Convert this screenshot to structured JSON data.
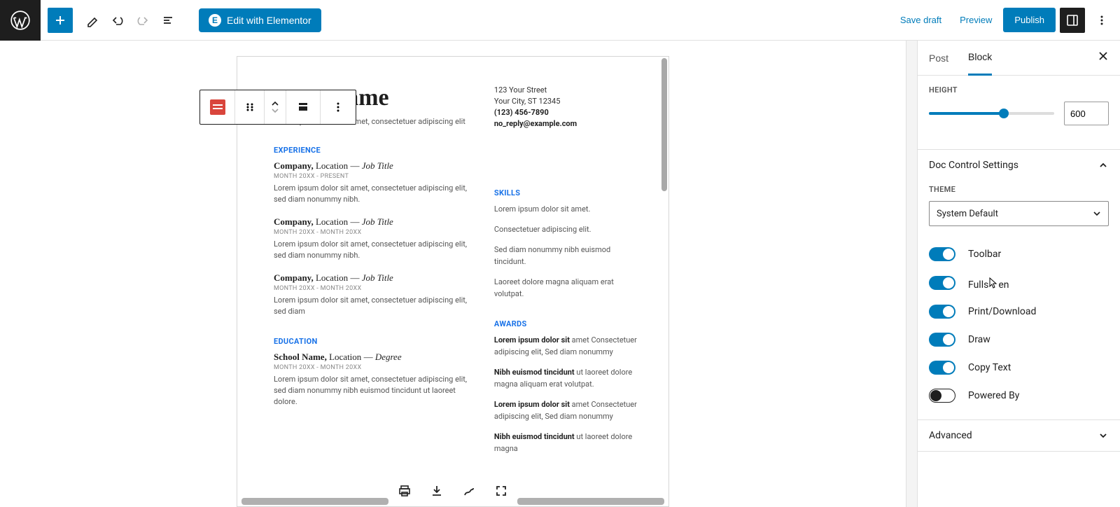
{
  "toolbar": {
    "edit_elementor": "Edit with Elementor",
    "save_draft": "Save draft",
    "preview": "Preview",
    "publish": "Publish"
  },
  "block_toolbar": {
    "icon": "pdf-block"
  },
  "document": {
    "name": "Your Name",
    "subtitle": "Lorem ipsum dolor sit amet, consectetuer adipiscing elit",
    "contact": {
      "street": "123 Your Street",
      "city": "Your City, ST 12345",
      "phone": "(123) 456-7890",
      "email": "no_reply@example.com"
    },
    "sections": {
      "experience": "EXPERIENCE",
      "education": "EDUCATION",
      "skills": "SKILLS",
      "awards": "AWARDS"
    },
    "jobs": [
      {
        "company": "Company,",
        "loc": " Location ",
        "dash": "— ",
        "title": "Job Title",
        "date": "MONTH 20XX - PRESENT",
        "desc": "Lorem ipsum dolor sit amet, consectetuer adipiscing elit, sed diam nonummy nibh."
      },
      {
        "company": "Company,",
        "loc": " Location ",
        "dash": "— ",
        "title": "Job Title",
        "date": "MONTH 20XX - MONTH 20XX",
        "desc": "Lorem ipsum dolor sit amet, consectetuer adipiscing elit, sed diam nonummy nibh."
      },
      {
        "company": "Company,",
        "loc": " Location ",
        "dash": "— ",
        "title": "Job Title",
        "date": "MONTH 20XX - MONTH 20XX",
        "desc": "Lorem ipsum dolor sit amet, consectetuer adipiscing elit, sed diam"
      }
    ],
    "education": {
      "school": "School Name,",
      "loc": " Location ",
      "dash": "— ",
      "deg": "Degree",
      "date": "MONTH 20XX - MONTH 20XX",
      "desc": "Lorem ipsum dolor sit amet, consectetuer adipiscing elit, sed diam nonummy nibh euismod tincidunt ut laoreet dolore."
    },
    "skills": {
      "l1": "Lorem ipsum dolor sit amet.",
      "l2": "Consectetuer adipiscing elit.",
      "l3": "Sed diam nonummy nibh euismod tincidunt.",
      "l4": "Laoreet dolore magna aliquam erat volutpat."
    },
    "awards": {
      "a1a": "Lorem ipsum dolor sit",
      "a1b": " amet Consectetuer adipiscing elit, Sed diam nonummy",
      "a2a": "Nibh euismod tincidunt",
      "a2b": " ut laoreet dolore magna aliquam erat volutpat.",
      "a3a": "Lorem ipsum dolor sit",
      "a3b": " amet Consectetuer adipiscing elit, Sed diam nonummy",
      "a4a": "Nibh euismod tincidunt",
      "a4b": " ut laoreet dolore magna"
    }
  },
  "panel": {
    "tab_post": "Post",
    "tab_block": "Block",
    "height_label": "HEIGHT",
    "height_value": "600",
    "doc_control": "Doc Control Settings",
    "theme_label": "THEME",
    "theme_value": "System Default",
    "toggles": {
      "toolbar": "Toolbar",
      "fullscreen": "Fullscreen",
      "print": "Print/Download",
      "draw": "Draw",
      "copy": "Copy Text",
      "powered": "Powered By"
    },
    "advanced": "Advanced"
  }
}
